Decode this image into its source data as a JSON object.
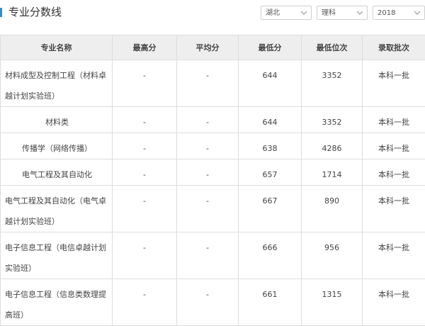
{
  "header": {
    "title": "专业分数线",
    "filters": {
      "province": "湖北",
      "subject": "理科",
      "year": "2018"
    }
  },
  "table": {
    "columns": [
      "专业名称",
      "最高分",
      "平均分",
      "最低分",
      "最低位次",
      "录取批次"
    ],
    "rows": [
      {
        "name": "材料成型及控制工程（材料卓越计划实验班）",
        "max": "-",
        "avg": "-",
        "min": "644",
        "rank": "3352",
        "batch": "本科一批"
      },
      {
        "name": "材料类",
        "max": "-",
        "avg": "-",
        "min": "644",
        "rank": "3352",
        "batch": "本科一批"
      },
      {
        "name": "传播学（网络传播）",
        "max": "-",
        "avg": "-",
        "min": "638",
        "rank": "4286",
        "batch": "本科一批"
      },
      {
        "name": "电气工程及其自动化",
        "max": "-",
        "avg": "-",
        "min": "657",
        "rank": "1714",
        "batch": "本科一批"
      },
      {
        "name": "电气工程及其自动化（电气卓越计划实验班）",
        "max": "-",
        "avg": "-",
        "min": "667",
        "rank": "890",
        "batch": "本科一批"
      },
      {
        "name": "电子信息工程（电信卓越计划实验班）",
        "max": "-",
        "avg": "-",
        "min": "666",
        "rank": "956",
        "batch": "本科一批"
      },
      {
        "name": "电子信息工程（信息类数理提高班）",
        "max": "-",
        "avg": "-",
        "min": "661",
        "rank": "1315",
        "batch": "本科一批"
      }
    ]
  },
  "colors": {
    "accent": "#2a8fd6",
    "header_bg": "#eeeeee",
    "border": "#dddddd"
  },
  "icons": {
    "title_marker": "vertical-bar",
    "dropdown": "chevron-down-icon"
  }
}
